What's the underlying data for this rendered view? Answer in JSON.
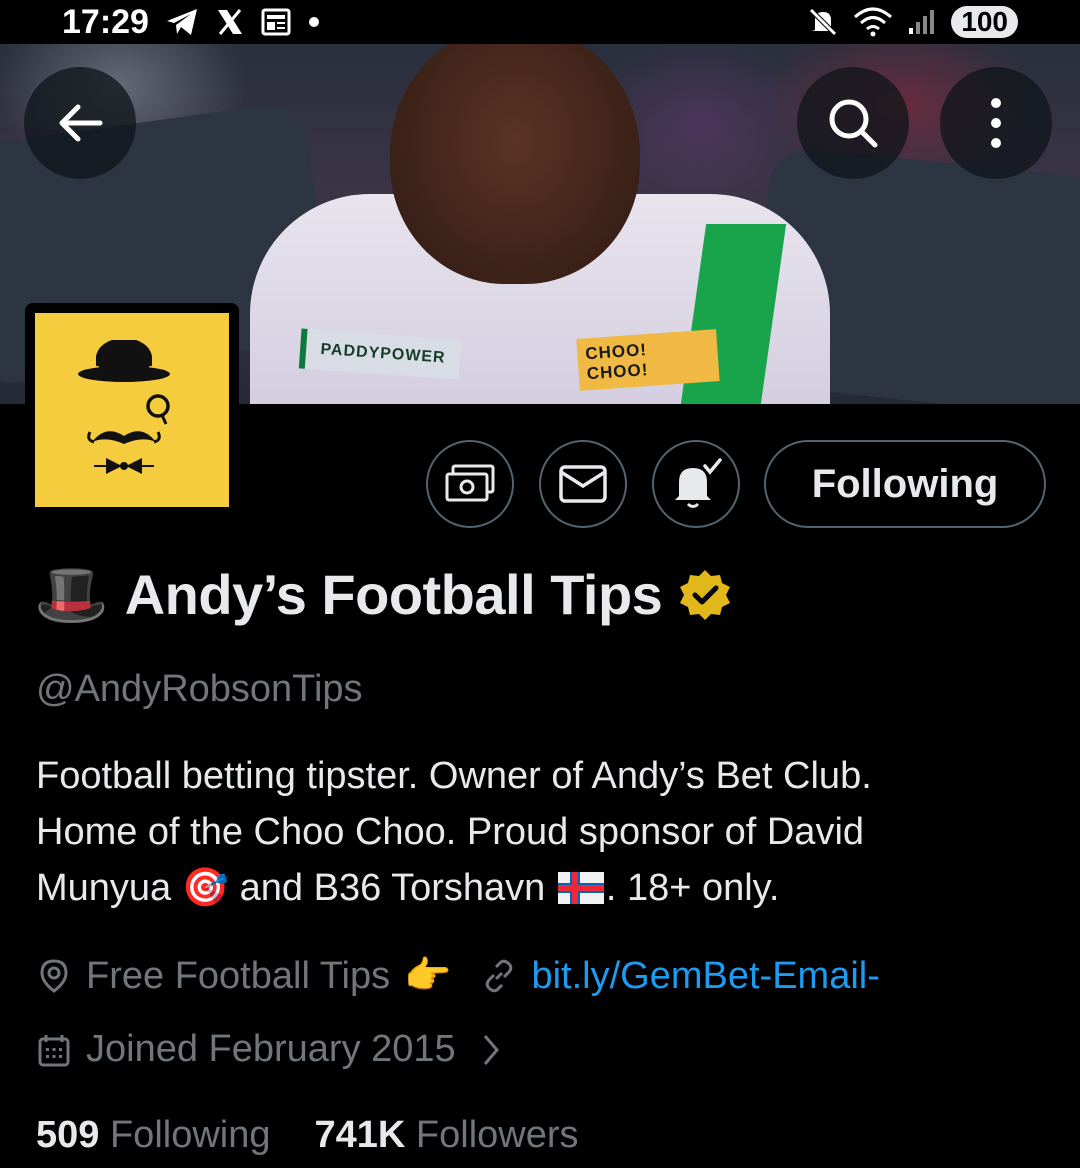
{
  "status_bar": {
    "time": "17:29",
    "battery": "100",
    "left_icons": [
      "telegram-icon",
      "x-icon",
      "news-icon",
      "dot-icon"
    ],
    "right_icons": [
      "mute-icon",
      "wifi-icon",
      "signal-icon"
    ]
  },
  "header": {
    "back_icon": "arrow-left-icon",
    "search_icon": "search-icon",
    "more_icon": "more-vertical-icon"
  },
  "banner": {
    "patch_left": "PADDYPOWER",
    "patch_right_line1": "CHOO!",
    "patch_right_line2": "CHOO!"
  },
  "actions": {
    "following_label": "Following",
    "icons": [
      "money-icon",
      "mail-icon",
      "bell-check-icon"
    ]
  },
  "profile": {
    "name_emoji": "🎩",
    "display_name": "Andy’s Football Tips",
    "verified_color": "#e2b719",
    "handle": "@AndyRobsonTips",
    "bio_line1": "Football betting tipster. Owner of Andy’s Bet Club.",
    "bio_line2": "Home of the Choo Choo. Proud sponsor of David",
    "bio_line3a": "Munyua ",
    "bio_emoji_dart": "🎯",
    "bio_line3b": " and B36 Torshavn ",
    "bio_line3c": ". 18+ only.",
    "location": "Free Football Tips",
    "location_emoji": "👉",
    "link": "bit.ly/GemBet-Email-",
    "joined": "Joined February 2015",
    "following_count": "509",
    "following_label": "Following",
    "followers_count": "741K",
    "followers_label": "Followers"
  },
  "colors": {
    "background": "#000000",
    "accent_link": "#1d9bf0",
    "muted_text": "#71767b",
    "avatar_bg": "#f5cc3d"
  }
}
